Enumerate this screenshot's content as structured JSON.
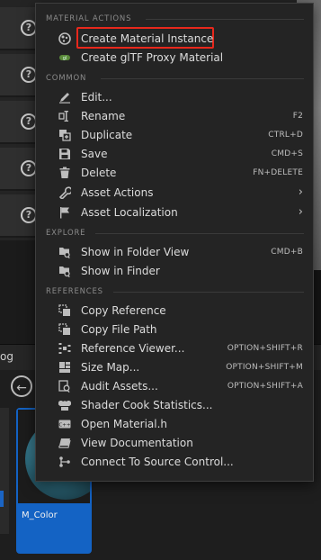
{
  "background": {
    "help_icon_glyph": "?",
    "log_tab_label": "og",
    "asset": {
      "name": "M_Color"
    }
  },
  "menu": {
    "sections": {
      "material_actions": "MATERIAL ACTIONS",
      "common": "COMMON",
      "explore": "EXPLORE",
      "references": "REFERENCES"
    },
    "items": {
      "create_material_instance": "Create Material Instance",
      "create_gltf_proxy": "Create glTF Proxy Material",
      "edit": "Edit...",
      "rename": {
        "label": "Rename",
        "shortcut": "F2"
      },
      "duplicate": {
        "label": "Duplicate",
        "shortcut": "CTRL+D"
      },
      "save": {
        "label": "Save",
        "shortcut": "CMD+S"
      },
      "delete": {
        "label": "Delete",
        "shortcut": "FN+DELETE"
      },
      "asset_actions": "Asset Actions",
      "asset_localization": "Asset Localization",
      "show_in_folder_view": {
        "label": "Show in Folder View",
        "shortcut": "CMD+B"
      },
      "show_in_finder": "Show in Finder",
      "copy_reference": "Copy Reference",
      "copy_file_path": "Copy File Path",
      "reference_viewer": {
        "label": "Reference Viewer...",
        "shortcut": "OPTION+SHIFT+R"
      },
      "size_map": {
        "label": "Size Map...",
        "shortcut": "OPTION+SHIFT+M"
      },
      "audit_assets": {
        "label": "Audit Assets...",
        "shortcut": "OPTION+SHIFT+A"
      },
      "shader_cook_statistics": "Shader Cook Statistics...",
      "open_material_h": "Open Material.h",
      "view_documentation": "View Documentation",
      "connect_to_source_control": "Connect To Source Control..."
    },
    "submenu_arrow": "›"
  },
  "colors": {
    "highlight_border": "#e8281c",
    "asset_tile": "#1463c4"
  }
}
